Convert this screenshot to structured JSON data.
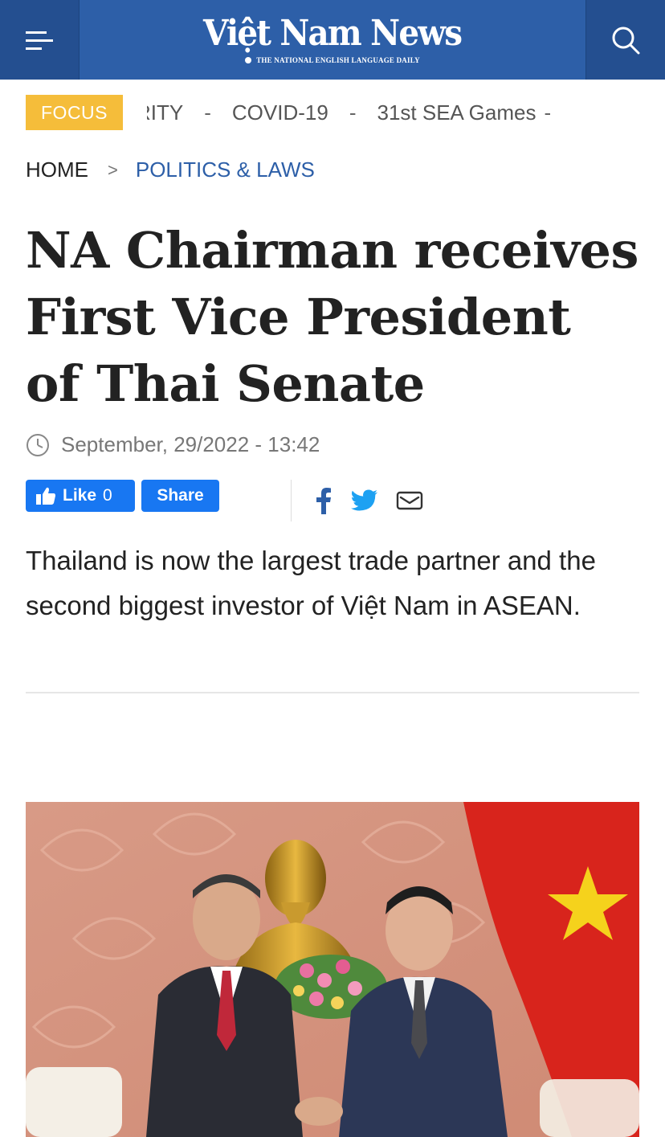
{
  "header": {
    "logo_text": "Việt Nam News",
    "logo_tagline": "THE NATIONAL ENGLISH LANGUAGE DAILY",
    "menu_icon": "hamburger-menu-icon",
    "search_icon": "search-icon"
  },
  "focus": {
    "badge": "FOCUS",
    "items": [
      "RITY",
      "COVID-19",
      "31st SEA Games"
    ],
    "separator": "-"
  },
  "breadcrumb": {
    "home": "HOME",
    "separator": ">",
    "category": "POLITICS & LAWS"
  },
  "article": {
    "title": "NA Chairman receives First Vice President of Thai Senate",
    "date": "September, 29/2022 - 13:42",
    "sapo": "Thailand is now the largest trade partner and the second biggest investor of Việt Nam in ASEAN."
  },
  "social": {
    "like_label": "Like",
    "like_count": "0",
    "share_label": "Share",
    "icons": [
      "facebook-icon",
      "twitter-icon",
      "email-icon"
    ]
  },
  "colors": {
    "brand_blue": "#2d5fa8",
    "focus_yellow": "#f5bd3a",
    "facebook_blue": "#1877f2",
    "twitter_blue": "#1da1f2"
  }
}
